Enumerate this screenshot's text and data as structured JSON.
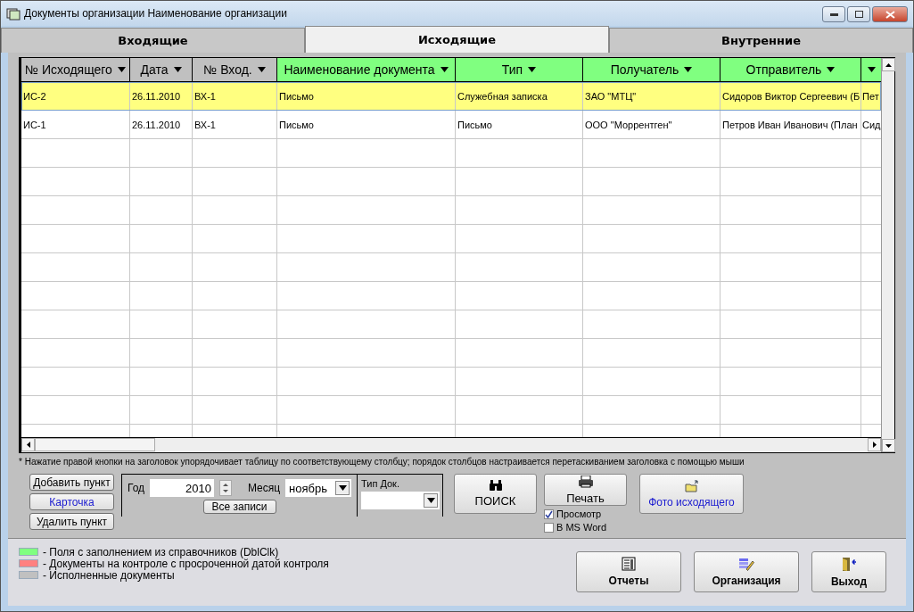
{
  "window": {
    "title": "Документы организации Наименование организации"
  },
  "tabs": [
    {
      "label": "Входящие",
      "selected": false
    },
    {
      "label": "Исходящие",
      "selected": true
    },
    {
      "label": "Внутренние",
      "selected": false
    }
  ],
  "table": {
    "columns": [
      {
        "label": "№ Исходящего",
        "color": "#c0c0c0"
      },
      {
        "label": "Дата",
        "color": "#c0c0c0"
      },
      {
        "label": "№ Вход.",
        "color": "#c0c0c0"
      },
      {
        "label": "Наименование документа",
        "color": "#80ff80"
      },
      {
        "label": "Тип",
        "color": "#80ff80"
      },
      {
        "label": "Получатель",
        "color": "#80ff80"
      },
      {
        "label": "Отправитель",
        "color": "#80ff80"
      },
      {
        "color": "#80ff80"
      }
    ],
    "rows": [
      {
        "selected": true,
        "cells": [
          "ИС-2",
          "26.11.2010",
          "ВХ-1",
          "Письмо",
          "Служебная записка",
          "ЗАО \"МТЦ\"",
          "Сидоров Виктор Сергеевич (Б",
          "Пет"
        ]
      },
      {
        "selected": false,
        "cells": [
          "ИС-1",
          "26.11.2010",
          "ВХ-1",
          "Письмо",
          "Письмо",
          "ООО \"Моррентген\"",
          "Петров Иван Иванович (План",
          "Сид"
        ]
      }
    ]
  },
  "footnote": "* Нажатие правой кнопки на заголовок упорядочивает таблицу по соответствующему  столбцу;  порядок столбцов настраивается перетаскиванием заголовка с помощью мыши",
  "item_buttons": [
    {
      "label": "Добавить пункт",
      "kind": "plain"
    },
    {
      "label": "Карточка",
      "kind": "link"
    },
    {
      "label": "Удалить пункт",
      "kind": "plain"
    }
  ],
  "filter": {
    "year_label": "Год",
    "year": "2010",
    "month_label": "Месяц",
    "month": "ноябрь",
    "all_button": "Все записи",
    "doc_type_label": "Тип Док."
  },
  "search_button": "ПОИСК",
  "print_button": "Печать",
  "print_options": [
    {
      "label": "Просмотр",
      "checked": true
    },
    {
      "label": "В MS Word",
      "checked": false
    }
  ],
  "photo_button": "Фото исходящего",
  "legend": [
    {
      "color": "#80ff80",
      "label": "- Поля с заполнением из справочников (DblClk)"
    },
    {
      "color": "#ff8080",
      "label": "- Документы на контроле с просроченной датой контроля"
    },
    {
      "color": "#c0c0c0",
      "label": "- Исполненные документы"
    }
  ],
  "bottom_buttons": [
    {
      "label": "Отчеты",
      "kind": "reports"
    },
    {
      "label": "Организация",
      "kind": "organization"
    },
    {
      "label": "Выход",
      "kind": "exit"
    }
  ]
}
